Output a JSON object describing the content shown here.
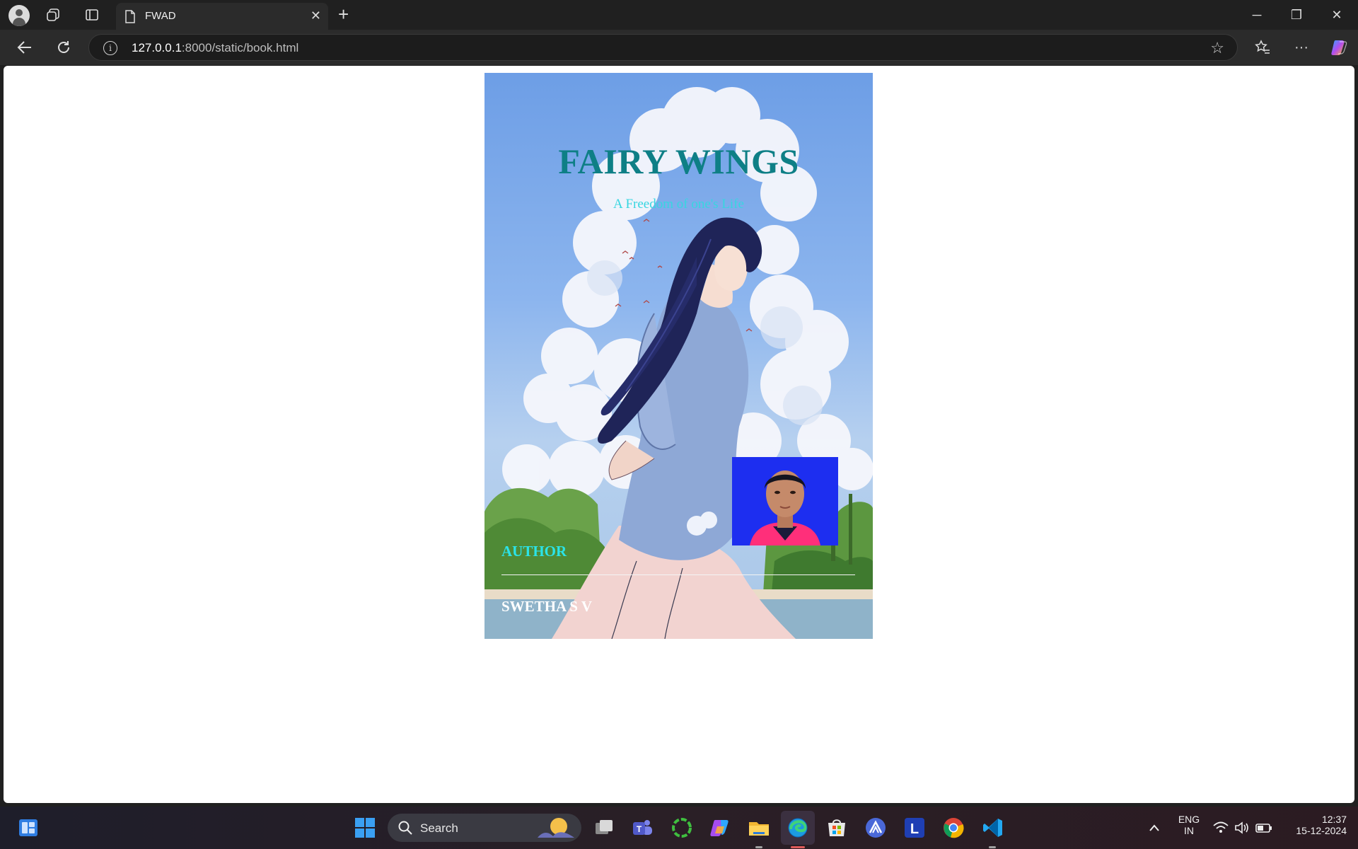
{
  "browser": {
    "tab": {
      "title": "FWAD",
      "close_glyph": "✕"
    },
    "new_tab_glyph": "+",
    "window_controls": {
      "minimize": "─",
      "maximize": "❐",
      "close": "✕"
    },
    "address": {
      "host": "127.0.0.1",
      "rest": ":8000/static/book.html"
    },
    "menu_glyph": "···"
  },
  "page": {
    "title": "FAIRY WINGS",
    "subtitle": "A Freedom of one's Life",
    "author_label": "AUTHOR",
    "author_name": "SWETHA S V"
  },
  "taskbar": {
    "search_label": "Search",
    "language": {
      "line1": "ENG",
      "line2": "IN"
    },
    "clock": {
      "time": "12:37",
      "date": "15-12-2024"
    }
  },
  "colors": {
    "title": "#0e7f86",
    "subtitle": "#37d6e0",
    "author_label": "#2be3e8",
    "photo_background": "#1d2ef0"
  }
}
